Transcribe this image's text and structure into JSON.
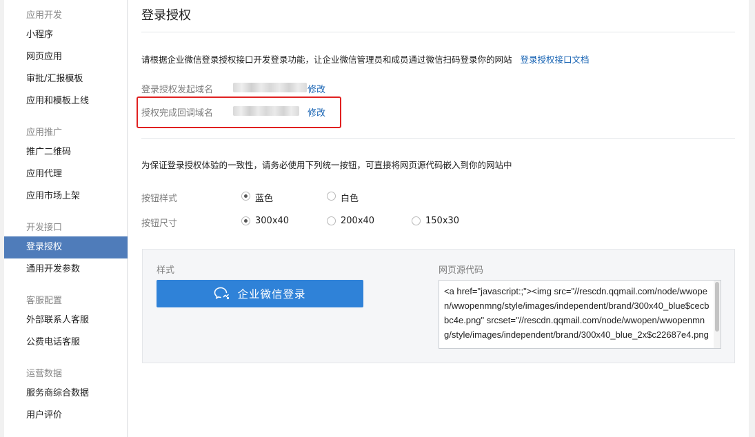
{
  "sidebar": {
    "groups": [
      {
        "title": "应用开发",
        "items": [
          "小程序",
          "网页应用",
          "审批/汇报模板",
          "应用和模板上线"
        ]
      },
      {
        "title": "应用推广",
        "items": [
          "推广二维码",
          "应用代理",
          "应用市场上架"
        ]
      },
      {
        "title": "开发接口",
        "items": [
          "登录授权",
          "通用开发参数"
        ]
      },
      {
        "title": "客服配置",
        "items": [
          "外部联系人客服",
          "公费电话客服"
        ]
      },
      {
        "title": "运营数据",
        "items": [
          "服务商综合数据",
          "用户评价"
        ]
      }
    ],
    "active_item": "登录授权"
  },
  "main": {
    "title": "登录授权",
    "intro": "请根据企业微信登录授权接口开发登录功能，让企业微信管理员和成员通过微信扫码登录你的网站",
    "doc_link": "登录授权接口文档",
    "fields": [
      {
        "label": "登录授权发起域名",
        "edit": "修改"
      },
      {
        "label": "授权完成回调域名",
        "edit": "修改"
      }
    ],
    "note": "为保证登录授权体验的一致性，请务必使用下列统一按钮，可直接将网页源代码嵌入到你的网站中",
    "button_style": {
      "label": "按钮样式",
      "options": [
        "蓝色",
        "白色"
      ],
      "selected": "蓝色"
    },
    "button_size": {
      "label": "按钮尺寸",
      "options": [
        "300x40",
        "200x40",
        "150x30"
      ],
      "selected": "300x40"
    },
    "preview": {
      "style_label": "样式",
      "button_text": "企业微信登录",
      "source_label": "网页源代码",
      "source_code": "<a href=\"javascript:;\"><img src=\"//rescdn.qqmail.com/node/wwopen/wwopenmng/style/images/independent/brand/300x40_blue$cecbbc4e.png\" srcset=\"//rescdn.qqmail.com/node/wwopen/wwopenmng/style/images/independent/brand/300x40_blue_2x$c22687e4.png"
    }
  },
  "colors": {
    "active_nav": "#4f7cba",
    "link": "#1a65b4",
    "login_button": "#2f82d8",
    "highlight_box": "#e02020"
  },
  "icons": {
    "login_button_icon": "wecom-chat-bubbles-icon"
  }
}
